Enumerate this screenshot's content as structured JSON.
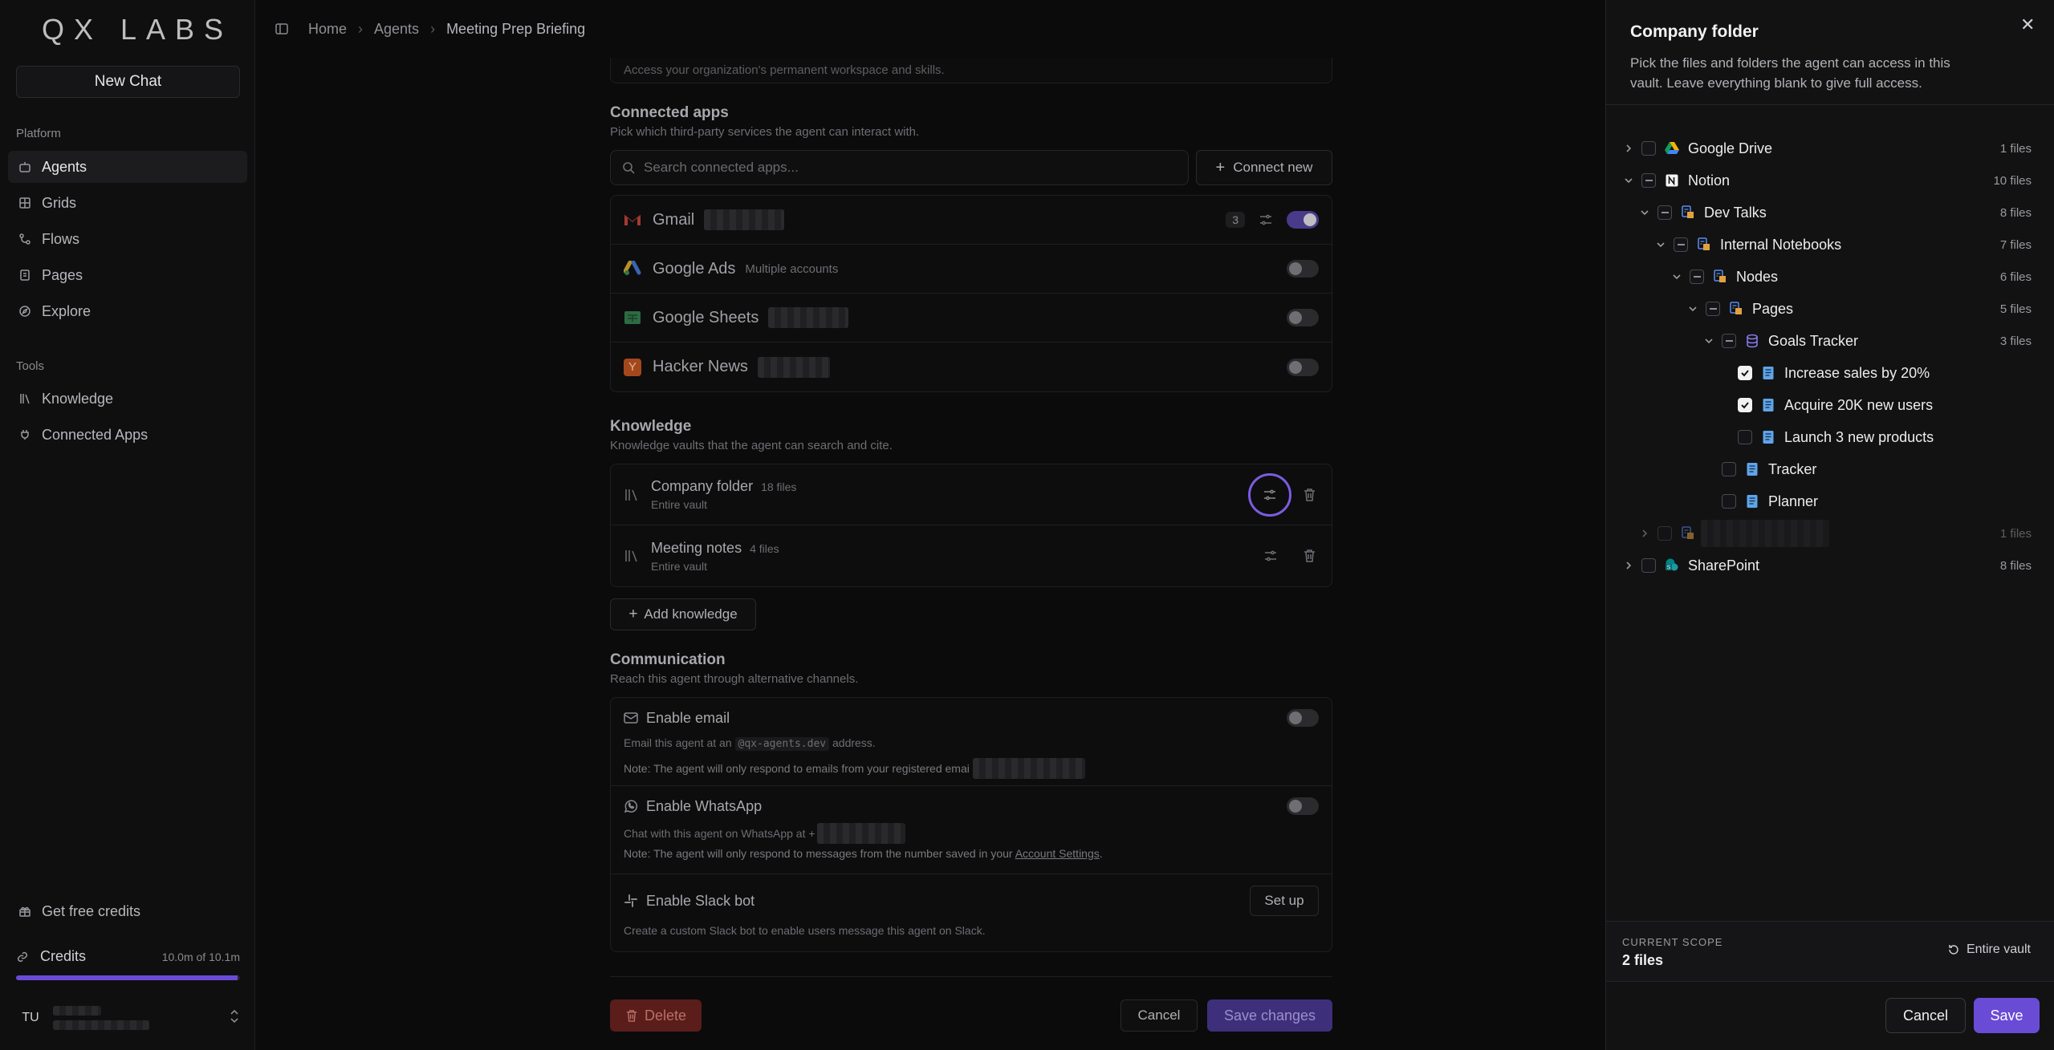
{
  "brand": "QX LABS",
  "sidebar": {
    "new_chat": "New Chat",
    "platform_label": "Platform",
    "platform_items": [
      "Agents",
      "Grids",
      "Flows",
      "Pages",
      "Explore"
    ],
    "tools_label": "Tools",
    "tools_items": [
      "Knowledge",
      "Connected Apps"
    ],
    "get_credits": "Get free credits",
    "credits_label": "Credits",
    "credits_value": "10.0m of 10.1m",
    "credits_fraction": 0.99,
    "user_initials": "TU"
  },
  "breadcrumb": [
    "Home",
    "Agents",
    "Meeting Prep Briefing"
  ],
  "main": {
    "workspace_cutoff": "Access your organization's permanent workspace and skills.",
    "connected_apps": {
      "title": "Connected apps",
      "subtitle": "Pick which third-party services the agent can interact with.",
      "search_placeholder": "Search connected apps...",
      "connect_new": "Connect new",
      "apps": [
        {
          "name": "Gmail",
          "note": "",
          "badge": "3",
          "enabled": true
        },
        {
          "name": "Google Ads",
          "note": "Multiple accounts",
          "badge": "",
          "enabled": false
        },
        {
          "name": "Google Sheets",
          "note": "",
          "badge": "",
          "enabled": false
        },
        {
          "name": "Hacker News",
          "note": "",
          "badge": "",
          "enabled": false
        }
      ]
    },
    "knowledge": {
      "title": "Knowledge",
      "subtitle": "Knowledge vaults that the agent can search and cite.",
      "vaults": [
        {
          "name": "Company folder",
          "count": "18 files",
          "scope": "Entire vault"
        },
        {
          "name": "Meeting notes",
          "count": "4 files",
          "scope": "Entire vault"
        }
      ],
      "add": "Add knowledge"
    },
    "communication": {
      "title": "Communication",
      "subtitle": "Reach this agent through alternative channels.",
      "email_title": "Enable email",
      "email_desc_pre": "Email this agent at an",
      "email_domain": "@qx-agents.dev",
      "email_desc_post": "address.",
      "email_note": "Note: The agent will only respond to emails from your registered emai",
      "wa_title": "Enable WhatsApp",
      "wa_desc": "Chat with this agent on WhatsApp at +",
      "wa_note_pre": "Note: The agent will only respond to messages from the number saved in your",
      "wa_note_link": "Account Settings",
      "wa_note_post": ".",
      "slack_title": "Enable Slack bot",
      "slack_desc": "Create a custom Slack bot to enable users message this agent on Slack.",
      "slack_btn": "Set up"
    },
    "footer": {
      "delete": "Delete",
      "cancel": "Cancel",
      "save": "Save changes"
    }
  },
  "panel": {
    "title": "Company folder",
    "description": "Pick the files and folders the agent can access in this vault. Leave everything blank to give full access.",
    "tree": [
      {
        "label": "Google Drive",
        "count": "1 files",
        "depth": 0,
        "chevron": "right",
        "check": "none",
        "icon": "google-drive-icon"
      },
      {
        "label": "Notion",
        "count": "10 files",
        "depth": 0,
        "chevron": "down",
        "check": "indet",
        "icon": "notion-icon"
      },
      {
        "label": "Dev Talks",
        "count": "8 files",
        "depth": 1,
        "chevron": "down",
        "check": "indet",
        "icon": "folder-doc-icon"
      },
      {
        "label": "Internal Notebooks",
        "count": "7 files",
        "depth": 2,
        "chevron": "down",
        "check": "indet",
        "icon": "folder-doc-icon"
      },
      {
        "label": "Nodes",
        "count": "6 files",
        "depth": 3,
        "chevron": "down",
        "check": "indet",
        "icon": "folder-doc-icon"
      },
      {
        "label": "Pages",
        "count": "5 files",
        "depth": 4,
        "chevron": "down",
        "check": "indet",
        "icon": "folder-doc-icon"
      },
      {
        "label": "Goals Tracker",
        "count": "3 files",
        "depth": 5,
        "chevron": "down",
        "check": "indet",
        "icon": "database-icon"
      },
      {
        "label": "Increase sales by 20%",
        "count": "",
        "depth": 6,
        "chevron": "",
        "check": "checked",
        "icon": "page-icon"
      },
      {
        "label": "Acquire 20K new users",
        "count": "",
        "depth": 6,
        "chevron": "",
        "check": "checked",
        "icon": "page-icon"
      },
      {
        "label": "Launch 3 new products",
        "count": "",
        "depth": 6,
        "chevron": "",
        "check": "none",
        "icon": "page-icon"
      },
      {
        "label": "Tracker",
        "count": "",
        "depth": 5,
        "chevron": "",
        "check": "none",
        "icon": "page-icon"
      },
      {
        "label": "Planner",
        "count": "",
        "depth": 5,
        "chevron": "",
        "check": "none",
        "icon": "page-icon"
      },
      {
        "label": "",
        "count": "1 files",
        "depth": 1,
        "chevron": "right",
        "check": "none",
        "icon": "folder-doc-icon"
      },
      {
        "label": "SharePoint",
        "count": "8 files",
        "depth": 0,
        "chevron": "right",
        "check": "none",
        "icon": "sharepoint-icon"
      }
    ],
    "scope_label": "CURRENT SCOPE",
    "scope_value": "2 files",
    "entire_vault": "Entire vault",
    "cancel": "Cancel",
    "save": "Save"
  },
  "colors": {
    "accent": "#6a4bd6",
    "panel_bg": "#121213",
    "page_bg": "#0b0b0c"
  }
}
